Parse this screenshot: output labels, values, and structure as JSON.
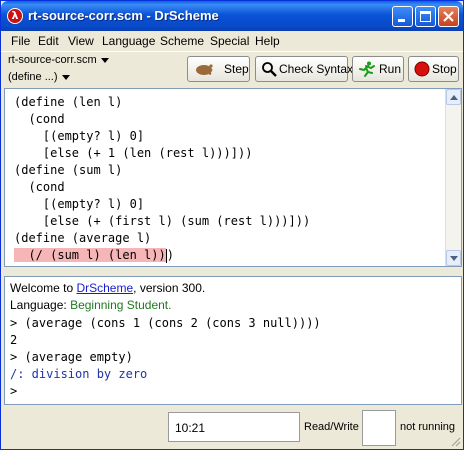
{
  "window": {
    "title": "rt-source-corr.scm - DrScheme",
    "app_icon_glyph": "λ"
  },
  "menubar": [
    "File",
    "Edit",
    "View",
    "Language",
    "Scheme",
    "Special",
    "Help"
  ],
  "toolbar": {
    "file_name": "rt-source-corr.scm",
    "define_menu": "(define ...)",
    "step_label": "Step",
    "check_syntax_label": "Check Syntax",
    "run_label": "Run",
    "stop_label": "Stop"
  },
  "editor": {
    "lines": [
      "(define (len l)",
      "  (cond",
      "    [(empty? l) 0]",
      "    [else (+ 1 (len (rest l)))]))",
      "(define (sum l)",
      "  (cond",
      "    [(empty? l) 0]",
      "    [else (+ (first l) (sum (rest l)))]))",
      "(define (average l)"
    ],
    "highlight_indent": "  ",
    "highlighted_expr": "(/ (sum l) (len l))",
    "after_highlight": ")",
    "highlight_color": "#f6b6b8"
  },
  "interactions": {
    "welcome_prefix": "Welcome to ",
    "welcome_link": "DrScheme",
    "welcome_suffix": ", version 300.",
    "language_prefix": "Language: ",
    "language_name": "Beginning Student",
    "language_suffix": ".",
    "prompt1": "> (average (cons 1 (cons 2 (cons 3 null))))",
    "result1": "2",
    "prompt2": "> (average empty)",
    "error": "/: division by zero",
    "prompt3": ">"
  },
  "statusbar": {
    "time": "10:21",
    "mode": "Read/Write",
    "running": "not running"
  },
  "colors": {
    "titlebar": "#0a54d8",
    "link": "#1b1bd0",
    "language": "#1f7a1f",
    "error": "#1f35a8"
  }
}
